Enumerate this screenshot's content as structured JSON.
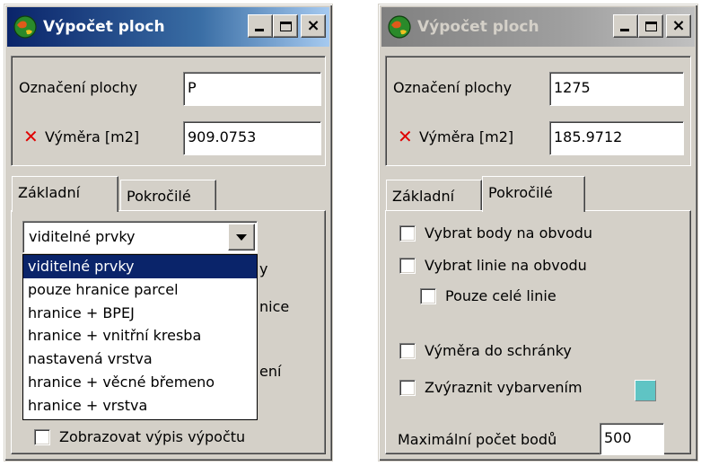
{
  "colors": {
    "active_title": "#0a246a",
    "inactive_title": "#808080",
    "face": "#d4d0c8",
    "highlight_swatch": "#5fc4c4",
    "error_mark": "#e00000"
  },
  "window_left": {
    "title": "Výpočet ploch",
    "icon": "app-globe-icon",
    "controls": {
      "minimize": "minimize-icon",
      "maximize": "maximize-icon",
      "close": "×"
    },
    "fields": {
      "designation_label": "Označení plochy",
      "designation_value": "P",
      "area_mark": "✕",
      "area_label": "Výměra [m2]",
      "area_value": "909.0753"
    },
    "tabs": [
      {
        "label": "Základní",
        "active": true
      },
      {
        "label": "Pokročilé",
        "active": false
      }
    ],
    "combo": {
      "value": "viditelné prvky",
      "options": [
        "viditelné prvky",
        "pouze hranice parcel",
        "hranice + BPEJ",
        "hranice + vnitřní kresba",
        "nastavená vrstva",
        "hranice + věcné břemeno",
        "hranice + vrstva"
      ],
      "selected_index": 0
    },
    "peek_texts": [
      "y",
      "nice",
      "ení"
    ],
    "bottom_check": {
      "label": "Zobrazovat výpis výpočtu",
      "checked": false
    }
  },
  "window_right": {
    "title": "Výpočet ploch",
    "icon": "app-globe-icon",
    "controls": {
      "minimize": "minimize-icon",
      "maximize": "maximize-icon",
      "close": "×"
    },
    "fields": {
      "designation_label": "Označení plochy",
      "designation_value": "1275",
      "area_mark": "✕",
      "area_label": "Výměra [m2]",
      "area_value": "185.9712"
    },
    "tabs": [
      {
        "label": "Základní",
        "active": false
      },
      {
        "label": "Pokročilé",
        "active": true
      }
    ],
    "checks": [
      {
        "label": "Vybrat body na obvodu",
        "checked": false
      },
      {
        "label": "Vybrat linie na obvodu",
        "checked": false
      },
      {
        "label": "Pouze celé linie",
        "checked": false
      },
      {
        "label": "Výměra do schránky",
        "checked": false
      },
      {
        "label": "Zvýraznit vybarvením",
        "checked": false
      }
    ],
    "max_points_label": "Maximální počet bodů",
    "max_points_value": "500"
  }
}
